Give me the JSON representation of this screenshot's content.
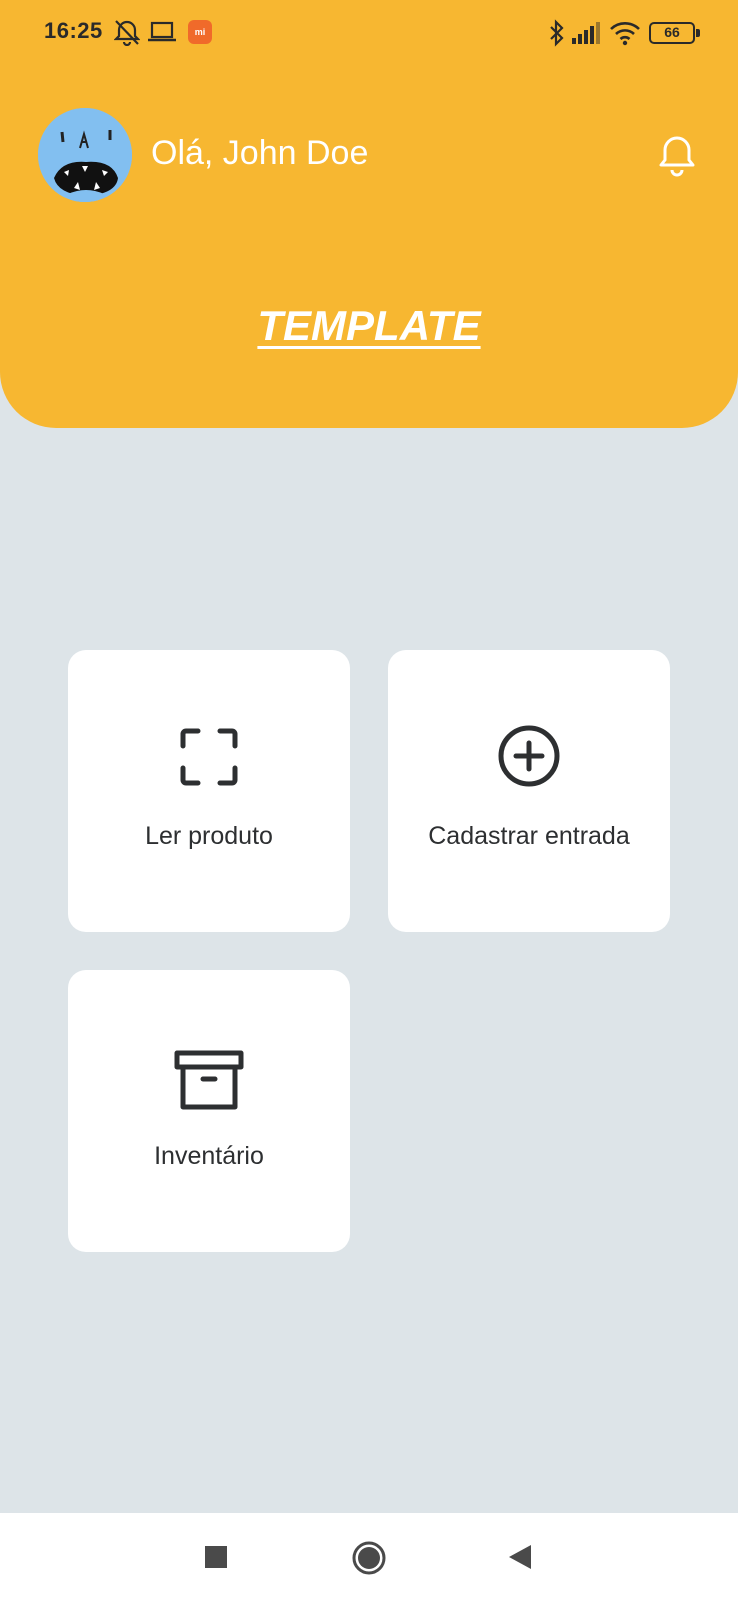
{
  "status_bar": {
    "time": "16:25",
    "icons": [
      "alarm-off-icon",
      "laptop-icon",
      "mi-app-icon",
      "bluetooth-icon",
      "signal-icon",
      "wifi-icon",
      "battery-icon"
    ],
    "mi_badge": "mi",
    "battery_level": "66"
  },
  "header": {
    "greeting": "Olá, John Doe",
    "title": "TEMPLATE",
    "background_color": "#f7b731",
    "avatar_icon": "monster-avatar",
    "notification_icon": "bell-icon"
  },
  "cards": [
    {
      "label": "Ler produto",
      "icon": "scan-frame-icon"
    },
    {
      "label": "Cadastrar entrada",
      "icon": "add-circle-icon"
    },
    {
      "label": "Inventário",
      "icon": "archive-box-icon"
    }
  ],
  "nav_bar": {
    "buttons": [
      "recent-apps-icon",
      "home-icon",
      "back-icon"
    ]
  },
  "colors": {
    "page_background": "#dde4e8",
    "card_background": "#ffffff",
    "icon_color": "#2d2f31"
  }
}
